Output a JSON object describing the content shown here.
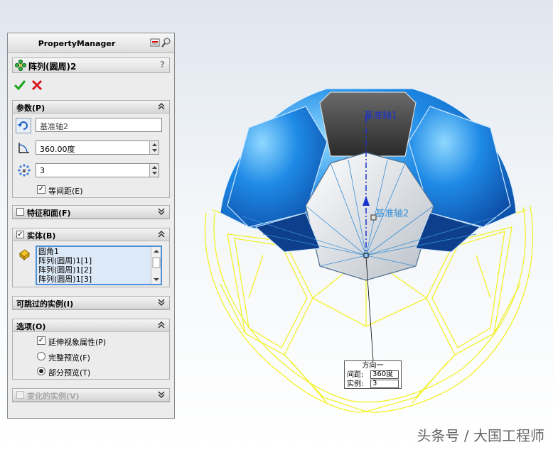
{
  "panel": {
    "title": "PropertyManager",
    "feature_name": "阵列(圆周)2",
    "help": "?"
  },
  "params": {
    "header": "参数(P)",
    "axis_value": "基准轴2",
    "angle_value": "360.00度",
    "count_value": "3",
    "equal_spacing": "等间距(E)"
  },
  "features_faces": {
    "header": "特征和面(F)"
  },
  "bodies": {
    "header": "实体(B)",
    "items": [
      "圆角1",
      "阵列(圆周)1[1]",
      "阵列(圆周)1[2]",
      "阵列(圆周)1[3]"
    ]
  },
  "skip_instances": {
    "header": "可跳过的实例(I)"
  },
  "options": {
    "header": "选项(O)",
    "extend_visual": "延伸视象属性(P)",
    "full_preview": "完整预览(F)",
    "partial_preview": "部分预览(T)"
  },
  "varied_instances": {
    "header": "变化的实例(V)"
  },
  "viewport": {
    "axis1_label": "基准轴1",
    "axis2_label": "基准轴2",
    "callout_title": "方向一",
    "callout_spacing_label": "间距:",
    "callout_spacing_value": "360度",
    "callout_count_label": "实例:",
    "callout_count_value": "3"
  },
  "watermark": "头条号 / 大国工程师",
  "colors": {
    "body_blue": "#1e8ae6",
    "preview_yellow": "#f2f22a",
    "ok_green": "#1aa51a",
    "cancel_red": "#d8141e",
    "axis_blue": "#1a33cc"
  }
}
